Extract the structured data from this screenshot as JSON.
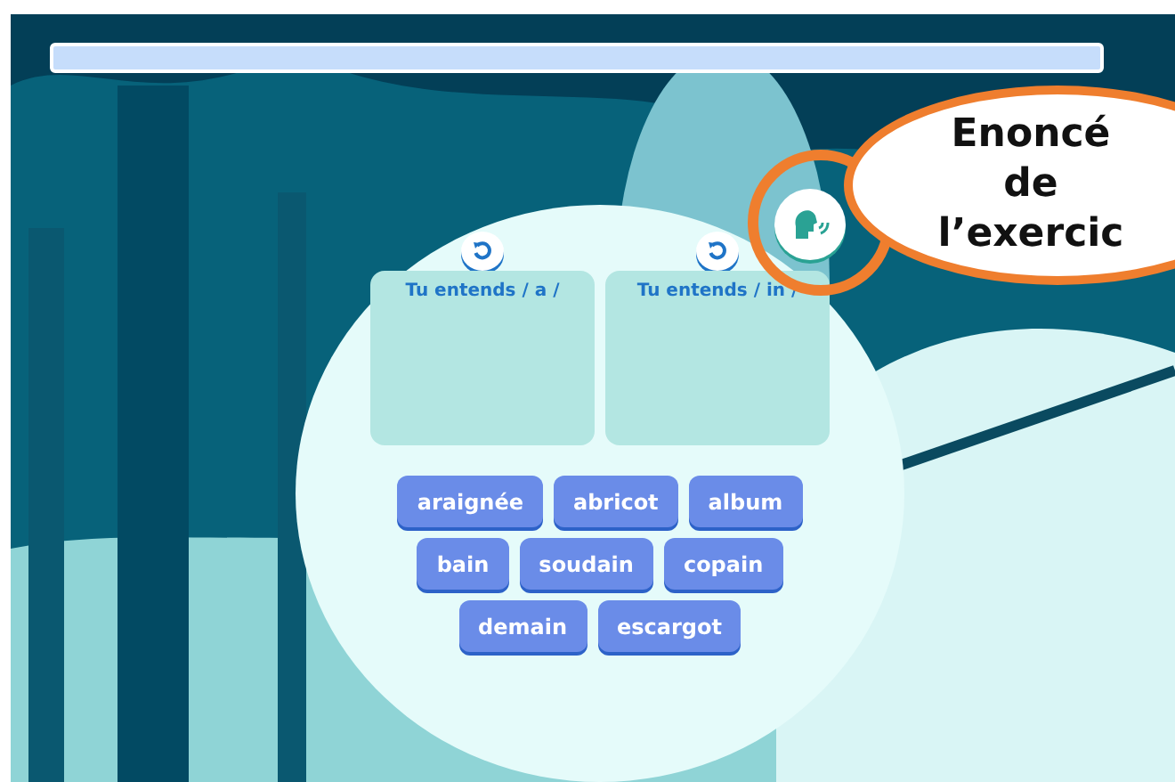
{
  "progress": {
    "level": 0
  },
  "columns": [
    {
      "title": "Tu entends / a /"
    },
    {
      "title": "Tu entends / in /"
    }
  ],
  "word_rows": [
    [
      "araignée",
      "abricot",
      "album"
    ],
    [
      "bain",
      "soudain",
      "copain"
    ],
    [
      "demain",
      "escargot"
    ]
  ],
  "callout": {
    "lines": [
      "Enoncé",
      "de",
      "l’exercic"
    ]
  }
}
